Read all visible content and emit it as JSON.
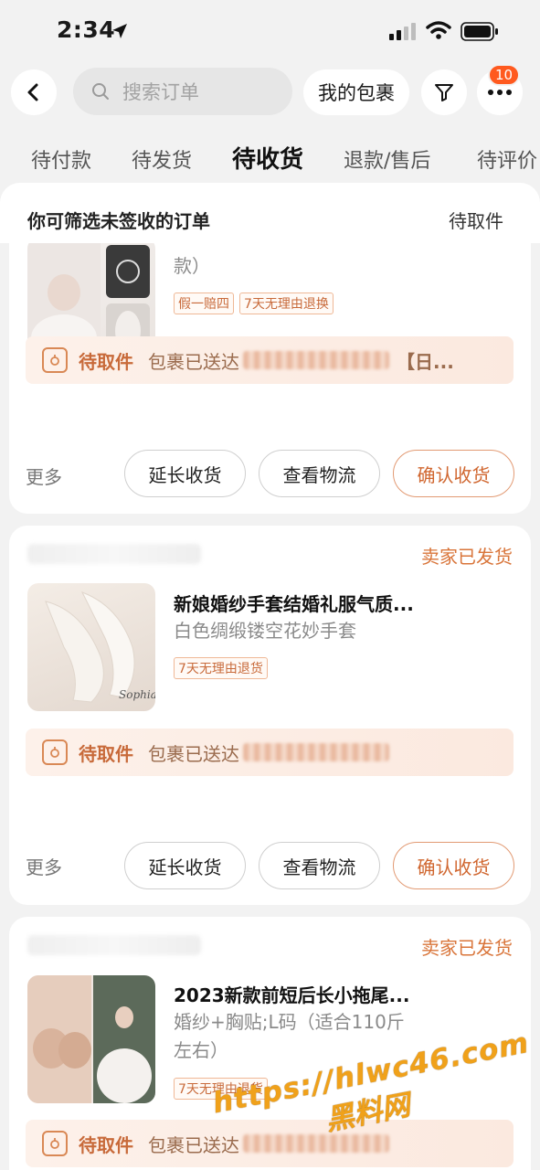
{
  "status_bar": {
    "time": "2:34"
  },
  "header": {
    "search_placeholder": "搜索订单",
    "packages_label": "我的包裹",
    "badge_count": "10"
  },
  "tabs": [
    {
      "label": "待付款"
    },
    {
      "label": "待发货"
    },
    {
      "label": "待收货",
      "active": true
    },
    {
      "label": "退款/售后"
    },
    {
      "label": "待评价"
    }
  ],
  "filter_hint": {
    "text": "你可筛选未签收的订单",
    "link": "待取件"
  },
  "orders": [
    {
      "status": "",
      "title": "",
      "sku_line2": "款）",
      "tags": [
        "假一赔四",
        "7天无理由退换"
      ],
      "logistics_label": "待取件",
      "logistics_text": "包裹已送达",
      "logistics_suffix": "【日...",
      "more": "更多",
      "buttons": [
        "延长收货",
        "查看物流",
        "确认收货"
      ]
    },
    {
      "status": "卖家已发货",
      "title": "新娘婚纱手套结婚礼服气质...",
      "sku": "白色绸缎镂空花妙手套",
      "tags": [
        "7天无理由退货"
      ],
      "thumb_text": "Sophia",
      "logistics_label": "待取件",
      "logistics_text": "包裹已送达",
      "more": "更多",
      "buttons": [
        "延长收货",
        "查看物流",
        "确认收货"
      ]
    },
    {
      "status": "卖家已发货",
      "title": "2023新款前短后长小拖尾...",
      "sku_line1": "婚纱+胸贴;L码（适合110斤",
      "sku_line2": "左右）",
      "tags": [
        "7天无理由退货"
      ],
      "logistics_label": "待取件",
      "logistics_text": "包裹已送达"
    }
  ],
  "watermark": {
    "line1": "https://hlwc46.com",
    "line2": "黑料网"
  },
  "colors": {
    "accent": "#d0662f",
    "badge": "#ff5a1f",
    "tag_border": "#efb896"
  }
}
